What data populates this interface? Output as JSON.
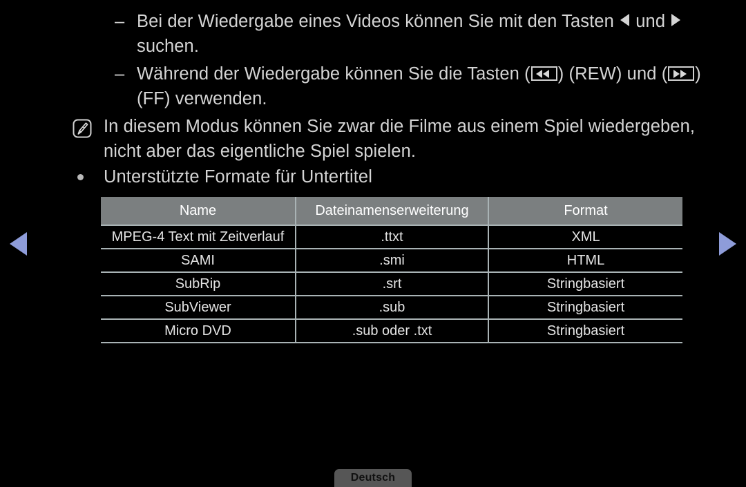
{
  "page": {
    "background_color": "#000000",
    "text_color": "#d4d4d4"
  },
  "nav": {
    "prev_icon": "triangle-left-icon",
    "next_icon": "triangle-right-icon",
    "arrow_color": "#8e9cd9"
  },
  "body_lines": [
    {
      "type": "dash",
      "marker": "–",
      "text_before": "Bei der Wiedergabe eines Videos können Sie mit den Tasten",
      "glyph_1": "triangle-left-icon",
      "text_middle": "und",
      "glyph_2": "triangle-right-icon",
      "text_after": "suchen."
    },
    {
      "type": "dash",
      "marker": "–",
      "text_before": "Während der Wiedergabe können Sie die Tasten (",
      "glyph_1": "rewind-key-icon",
      "text_middle": ") (REW) und (",
      "glyph_2": "fast-forward-key-icon",
      "text_after": ") (FF) verwenden."
    },
    {
      "type": "note",
      "icon": "note-pencil-icon",
      "text": "In diesem Modus können Sie zwar die Filme aus einem Spiel wiedergeben, nicht aber das eigentliche Spiel spielen."
    },
    {
      "type": "dot",
      "text": "Unterstützte Formate für Untertitel"
    }
  ],
  "table": {
    "header_bg": "#7b7f80",
    "border_color": "#a9b3b5",
    "columns": [
      "Name",
      "Dateinamenserweiterung",
      "Format"
    ],
    "rows": [
      [
        "MPEG-4 Text mit Zeitverlauf",
        ".ttxt",
        "XML"
      ],
      [
        "SAMI",
        ".smi",
        "HTML"
      ],
      [
        "SubRip",
        ".srt",
        "Stringbasiert"
      ],
      [
        "SubViewer",
        ".sub",
        "Stringbasiert"
      ],
      [
        "Micro DVD",
        ".sub oder .txt",
        "Stringbasiert"
      ]
    ]
  },
  "footer": {
    "language_label": "Deutsch",
    "chip_bg": "#565656"
  }
}
